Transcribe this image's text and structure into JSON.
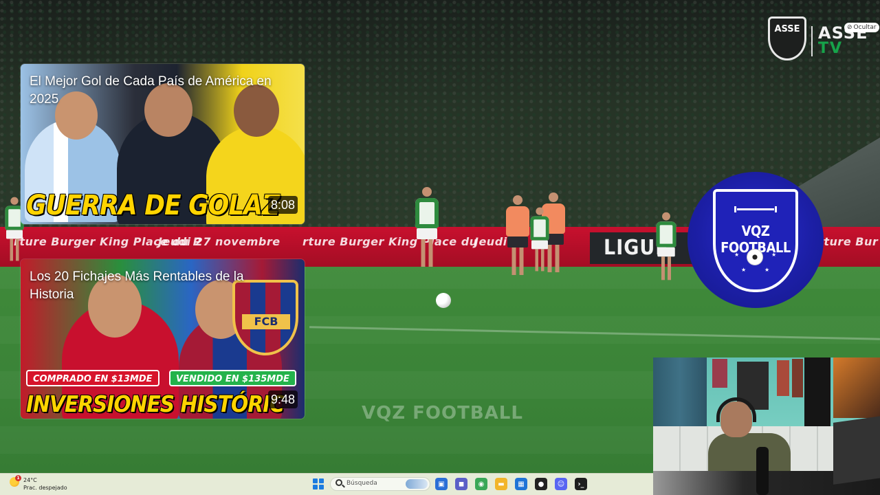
{
  "overlay": {
    "asse_badge_text": "ASSE",
    "asse_word": "ASSE",
    "asse_tv": "TV",
    "hide_button_label": "Ocultar"
  },
  "field": {
    "adboard_text_1": "rture Burger King Place du P",
    "adboard_text_2": "Jeudi 27 novembre",
    "adboard_text_3": "rture Burger King Place du",
    "adboard_text_4": "Jeudi 27",
    "adboard_text_5": "rture Bur",
    "ligue_text": "LIGUE",
    "watermark": "VQZ FOOTBALL"
  },
  "channel_logo": {
    "name": "VQZ FOOTBALL"
  },
  "cards": [
    {
      "title": "El Mejor Gol de Cada País de América en 2025",
      "headline": "GUERRA DE GOLAZ",
      "duration": "8:08"
    },
    {
      "title": "Los 20 Fichajes Más Rentables de la Historia",
      "headline": "INVERSIONES HISTÓRIC",
      "duration": "9:48",
      "pill_left": "COMPRADO EN $13MDE",
      "pill_right": "VENDIDO EN $135MDE",
      "crest_label": "FCB"
    }
  ],
  "taskbar": {
    "weather_temp": "24°C",
    "weather_desc": "Prac. despejado",
    "weather_badge": "1",
    "search_placeholder": "Búsqueda",
    "apps": [
      {
        "name": "task-view-icon",
        "glyph": "▣",
        "color": "#2b6fd6"
      },
      {
        "name": "chat-icon",
        "glyph": "◼",
        "color": "#5b5fc7"
      },
      {
        "name": "chrome-icon",
        "glyph": "◉",
        "color": "#3aa757"
      },
      {
        "name": "file-explorer-icon",
        "glyph": "▬",
        "color": "#f2b52a"
      },
      {
        "name": "store-icon",
        "glyph": "▦",
        "color": "#1f74d6"
      },
      {
        "name": "obs-icon",
        "glyph": "●",
        "color": "#222222"
      },
      {
        "name": "discord-icon",
        "glyph": "☺",
        "color": "#5865f2"
      },
      {
        "name": "terminal-icon",
        "glyph": "›_",
        "color": "#1e1e1e"
      }
    ]
  }
}
